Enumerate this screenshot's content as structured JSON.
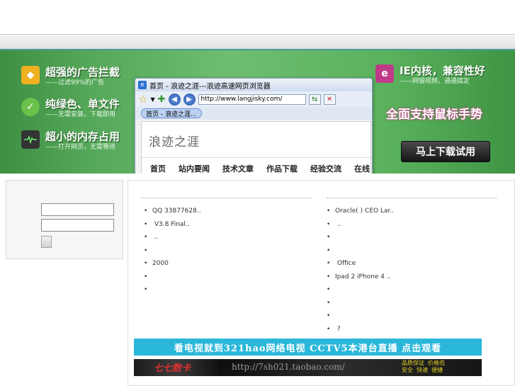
{
  "banner": {
    "features_left": [
      {
        "icon": "shield-icon",
        "icon_color": "#f0b020",
        "title": "超强的广告拦截",
        "subtitle": "——过滤99%的广告"
      },
      {
        "icon": "check-icon",
        "icon_color": "#6cc24a",
        "title": "纯绿色、单文件",
        "subtitle": "——无需安装，下载即用"
      },
      {
        "icon": "monitor-icon",
        "icon_color": "#333333",
        "title": "超小的内存占用",
        "subtitle": "——打开网页，无需等待"
      }
    ],
    "feature_right": {
      "icon": "ie-icon",
      "icon_color": "#c03a8a",
      "title": "IE内核，兼容性好",
      "subtitle": "——网银视频，通通搞定"
    },
    "gesture_text": "全面支持鼠标手势",
    "download_label": "马上下载试用",
    "browser": {
      "title": "首页 - 浪迹之涯---浪迹高速网页浏览器",
      "address": "http://www.langjisky.com/",
      "tab_label": "首页 - 浪迹之涯...",
      "site_logo": "浪迹之涯",
      "menu": [
        "首页",
        "站内要闻",
        "技术文章",
        "作品下载",
        "经验交流",
        "在线"
      ]
    }
  },
  "login": {
    "username_value": "",
    "password_value": ""
  },
  "news_left": [
    "QQ    33877628..",
    "     V3.8 Final..",
    "          ..",
    "",
    "2000",
    "",
    ""
  ],
  "news_right": [
    "Oracle(   ) CEO Lar..",
    "             ..",
    "",
    "",
    " Office",
    "Ipad 2  iPhone 4     ..",
    "",
    "",
    "",
    "        ?"
  ],
  "ads": {
    "tv_text": "看电视就到321hao网络电视 CCTV5本港台直播 点击观看",
    "shop_name": "七七数卡",
    "shop_url": "http://7sh021.taobao.com/",
    "shop_tags": "品质保证  价格低\n安全  快速  便捷"
  },
  "colors": {
    "banner_green": "#56a85a",
    "ad_blue": "#2ab7da",
    "accent_teal": "#4a9a9a"
  }
}
